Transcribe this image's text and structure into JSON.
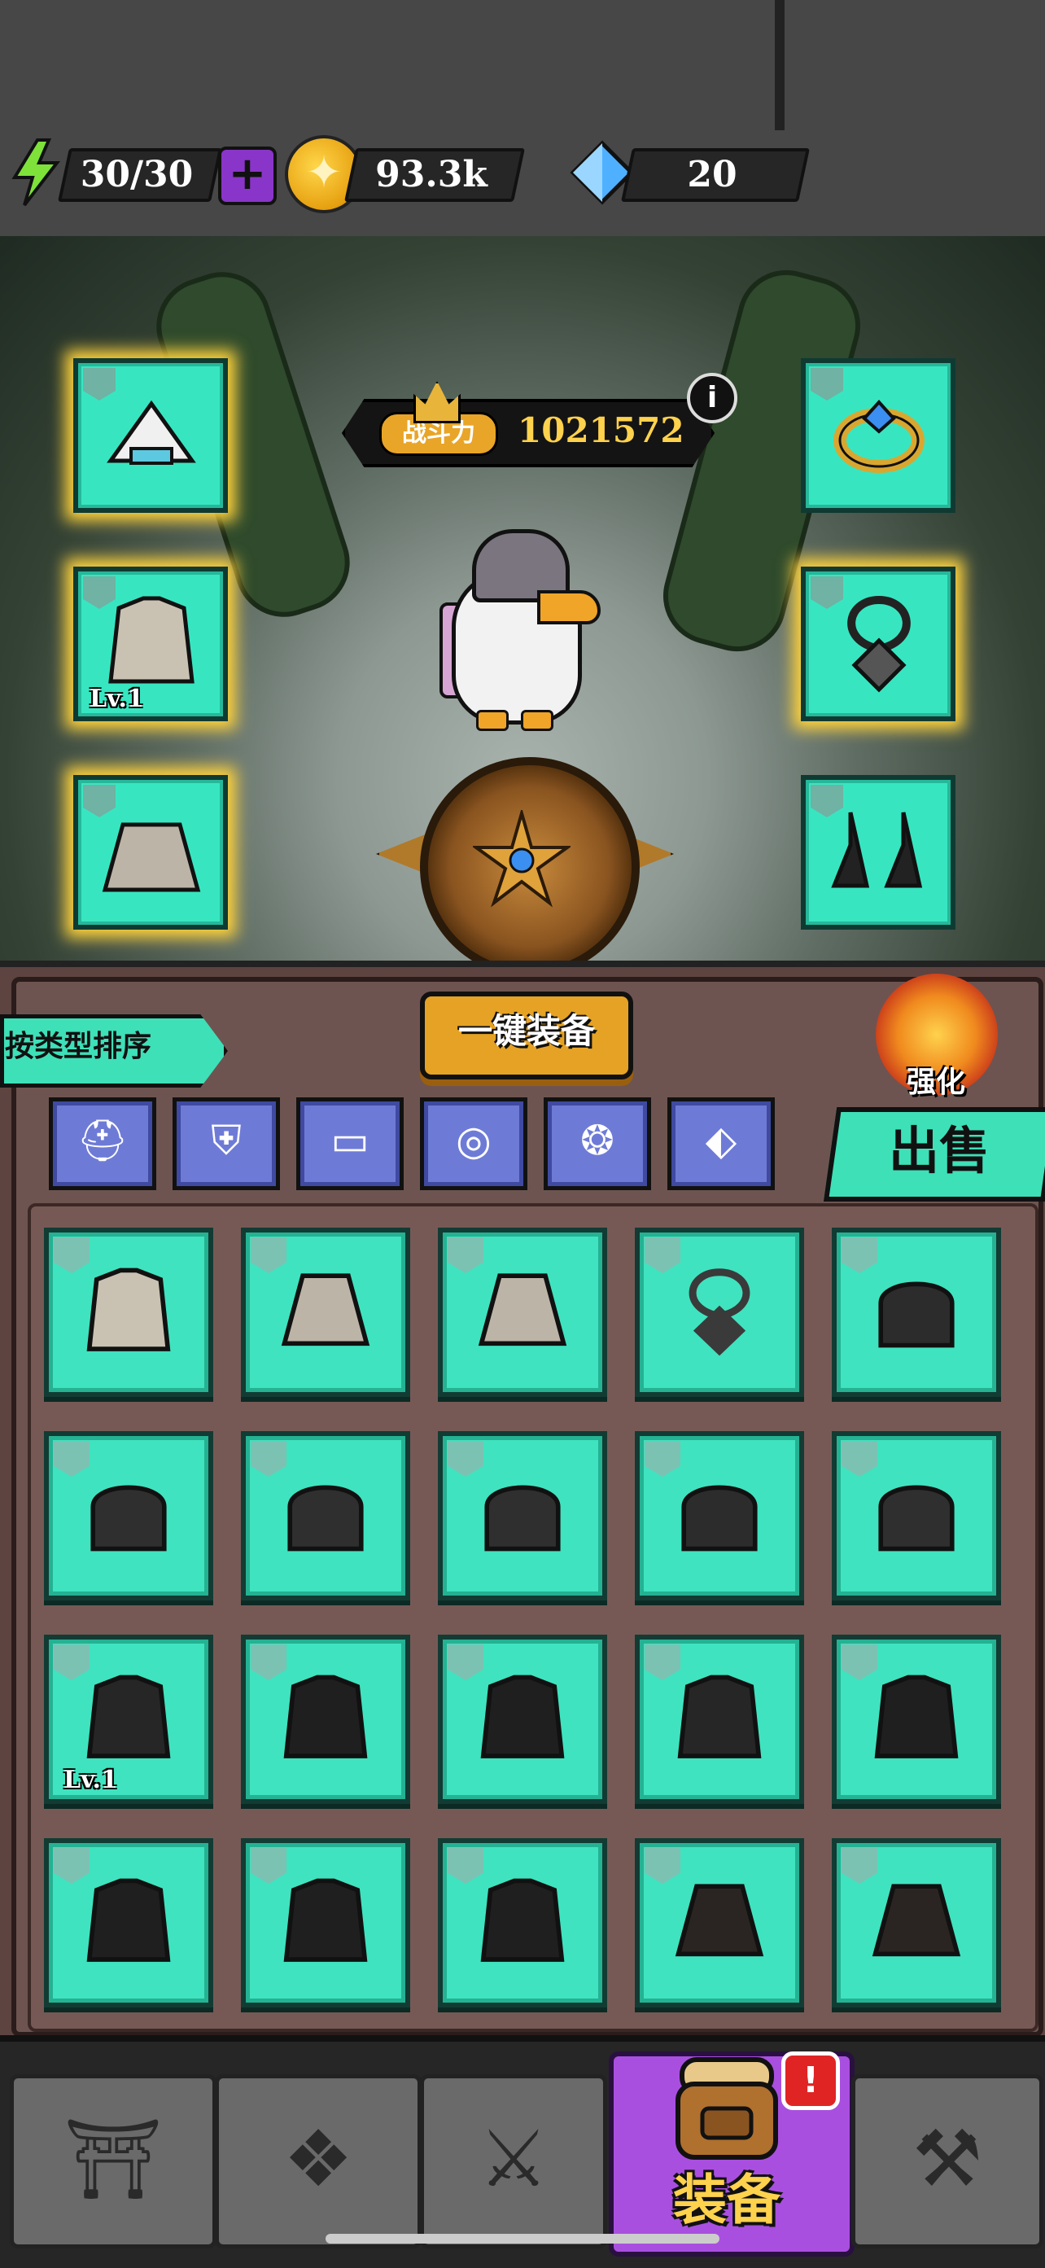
{
  "status_bar": {
    "energy": "30/30",
    "gold": "93.3k",
    "gems": "20",
    "add_symbol": "+"
  },
  "hero": {
    "power_label": "战斗力",
    "power_value": "1021572",
    "info_symbol": "i"
  },
  "equipped_left": [
    {
      "name": "hat",
      "level": ""
    },
    {
      "name": "coat",
      "level": "Lv.1"
    },
    {
      "name": "skirt",
      "level": ""
    }
  ],
  "equipped_right": [
    {
      "name": "ring",
      "level": ""
    },
    {
      "name": "necklace",
      "level": ""
    },
    {
      "name": "earrings",
      "level": ""
    }
  ],
  "panel": {
    "sort_label": "按类型排序",
    "equip_all_label": "一键装备",
    "upgrade_label": "强化",
    "sell_label": "出售"
  },
  "filters": [
    {
      "name": "helmet",
      "glyph": "⛑"
    },
    {
      "name": "armor",
      "glyph": "⛨"
    },
    {
      "name": "pants",
      "glyph": "▭"
    },
    {
      "name": "ring",
      "glyph": "◎"
    },
    {
      "name": "necklace",
      "glyph": "❂"
    },
    {
      "name": "earring",
      "glyph": "⬖"
    }
  ],
  "inventory": [
    {
      "type": "coat",
      "level": "",
      "color": "#c9c2b2"
    },
    {
      "type": "skirt",
      "level": "",
      "color": "#bdb4a8"
    },
    {
      "type": "skirt",
      "level": "",
      "color": "#bdb4a8"
    },
    {
      "type": "necklace",
      "level": "",
      "color": "#3a3a3a"
    },
    {
      "type": "helmet",
      "level": "",
      "color": "#2c2c2c"
    },
    {
      "type": "helmet",
      "level": "",
      "color": "#2f2f2f"
    },
    {
      "type": "helmet",
      "level": "",
      "color": "#2f2f2f"
    },
    {
      "type": "helmet",
      "level": "",
      "color": "#2f2f2f"
    },
    {
      "type": "helmet",
      "level": "",
      "color": "#2c2c2c"
    },
    {
      "type": "helmet",
      "level": "",
      "color": "#2f2f2f"
    },
    {
      "type": "coat",
      "level": "Lv.1",
      "color": "#262626"
    },
    {
      "type": "coat",
      "level": "",
      "color": "#1f1f1f"
    },
    {
      "type": "coat",
      "level": "",
      "color": "#1f1f1f"
    },
    {
      "type": "coat",
      "level": "",
      "color": "#262626"
    },
    {
      "type": "coat",
      "level": "",
      "color": "#1f1f1f"
    },
    {
      "type": "coat",
      "level": "",
      "color": "#1f1f1f"
    },
    {
      "type": "coat",
      "level": "",
      "color": "#1f1f1f"
    },
    {
      "type": "coat",
      "level": "",
      "color": "#1f1f1f"
    },
    {
      "type": "skirt",
      "level": "",
      "color": "#2a2522"
    },
    {
      "type": "skirt",
      "level": "",
      "color": "#2a2522"
    }
  ],
  "bottom_nav": {
    "tabs": [
      {
        "name": "shop",
        "glyph": "⛩"
      },
      {
        "name": "book",
        "glyph": "❖"
      },
      {
        "name": "battle",
        "glyph": "⚔"
      },
      {
        "name": "equipment",
        "glyph": ""
      },
      {
        "name": "forge",
        "glyph": "⚒"
      }
    ],
    "active_label": "装备",
    "badge": "!"
  },
  "colors": {
    "slot_teal": "#3fe3bf",
    "filter_blue": "#6e7bd6",
    "active_purple": "#a94fe0",
    "gold": "#ffd24d"
  }
}
